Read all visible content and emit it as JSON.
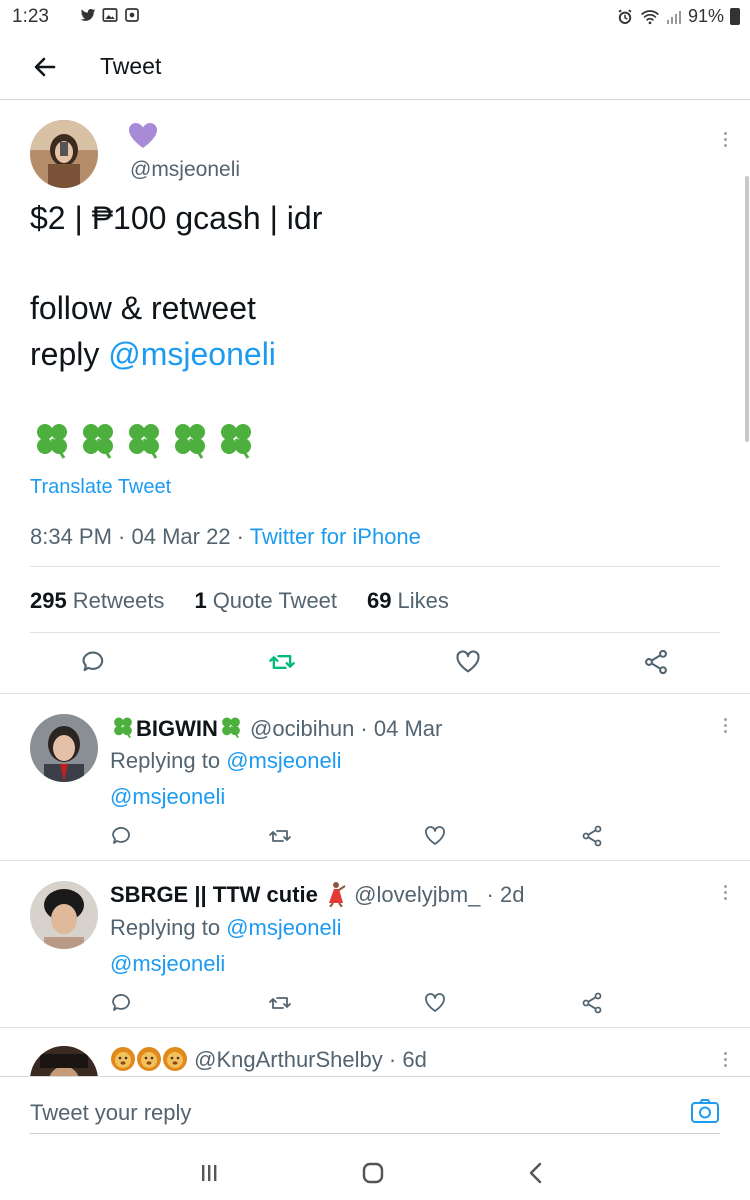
{
  "status_bar": {
    "time": "1:23",
    "battery": "91%",
    "left_icons": [
      "twitter-bird-icon",
      "image-icon",
      "screenshot-icon"
    ],
    "right_icons": [
      "alarm-icon",
      "wifi-icon",
      "signal-icon",
      "battery-icon"
    ]
  },
  "header": {
    "title": "Tweet",
    "back_icon": "back-arrow-icon"
  },
  "main_tweet": {
    "display_name_icon": "purple-heart-icon",
    "handle": "@msjeoneli",
    "line1": "$2 | ₱100 gcash | idr",
    "line2": "follow & retweet",
    "line3_prefix": "reply ",
    "line3_mention": "@msjeoneli",
    "clover_count": 5,
    "translate": "Translate Tweet",
    "time": "8:34 PM",
    "sep": " · ",
    "date": "04 Mar 22",
    "source": "Twitter for iPhone",
    "retweets_count": "295",
    "retweets_label": "Retweets",
    "quotes_count": "1",
    "quotes_label": "Quote Tweet",
    "likes_count": "69",
    "likes_label": "Likes",
    "retweet_active_color": "#00ba7c"
  },
  "replies": [
    {
      "name": "BIGWIN",
      "name_icons": [
        "clover-icon",
        "clover-icon"
      ],
      "handle": "@ocibihun",
      "time": "04 Mar",
      "replying_to_label": "Replying to",
      "replying_to": "@msjeoneli",
      "body": "@msjeoneli"
    },
    {
      "name": "SBRGE || TTW cutie",
      "name_icons": [
        "dancer-icon"
      ],
      "handle": "@lovelyjbm_",
      "time": "2d",
      "replying_to_label": "Replying to",
      "replying_to": "@msjeoneli",
      "body": "@msjeoneli"
    },
    {
      "name": "",
      "name_icons": [
        "lion-icon",
        "lion-icon",
        "lion-icon"
      ],
      "handle": "@KngArthurShelby",
      "time": "6d"
    }
  ],
  "reply_bar": {
    "placeholder": "Tweet your reply",
    "camera_icon": "camera-icon"
  },
  "nav_bar": {
    "icons": [
      "recents-icon",
      "home-icon",
      "back-icon"
    ]
  },
  "colors": {
    "accent": "#1d9bf0",
    "muted_text": "#536471",
    "clover_green": "#4caf3e",
    "purple": "#a78bd6"
  }
}
